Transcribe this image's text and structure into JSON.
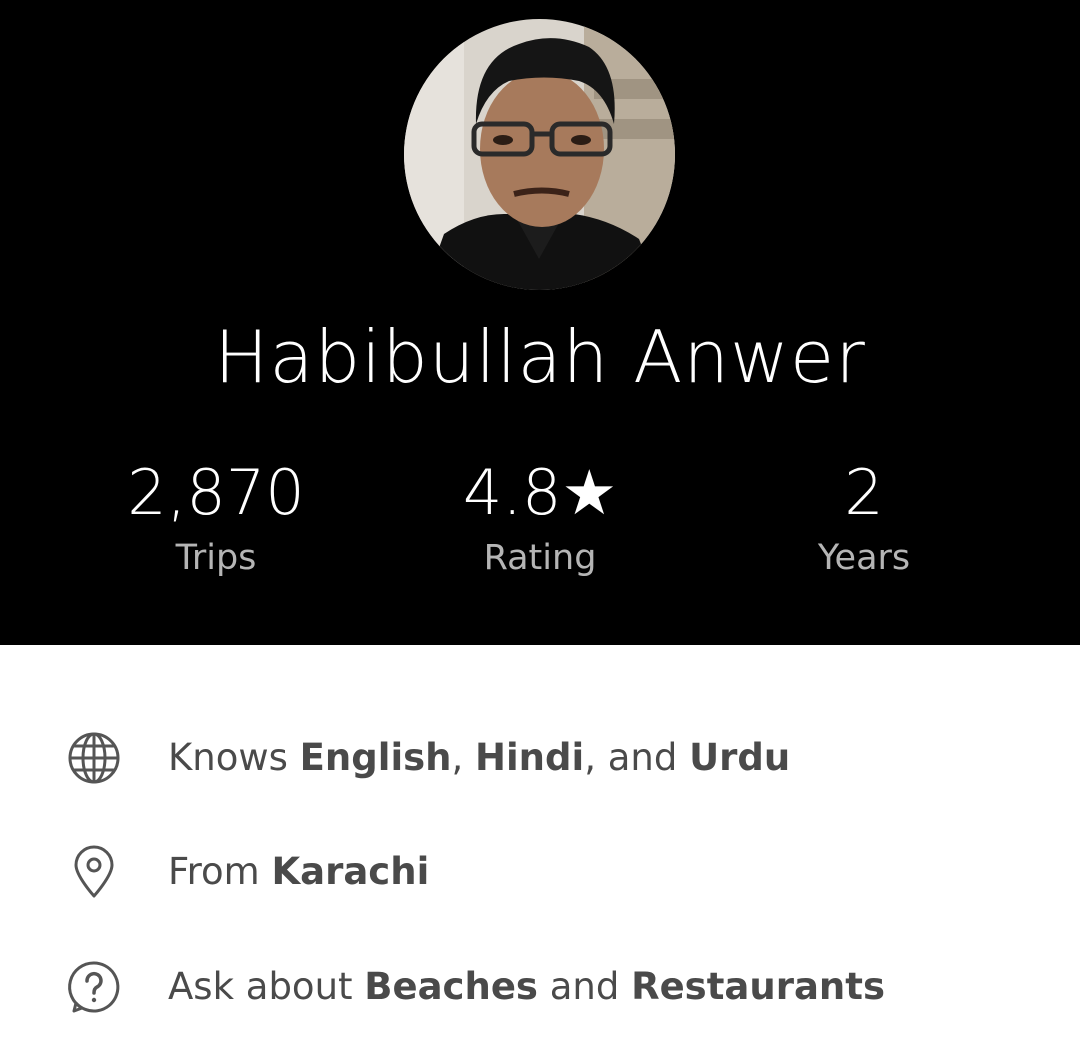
{
  "profile": {
    "name": "Habibullah Anwer",
    "avatar_alt": "driver-photo"
  },
  "stats": {
    "trips": {
      "value": "2,870",
      "label": "Trips"
    },
    "rating": {
      "value": "4.8★",
      "label": "Rating"
    },
    "years": {
      "value": "2",
      "label": "Years"
    }
  },
  "info": {
    "languages": {
      "icon": "globe-icon",
      "prefix": "Knows ",
      "lang1": "English",
      "sep1": ", ",
      "lang2": "Hindi",
      "sep2": ", and ",
      "lang3": "Urdu"
    },
    "from": {
      "icon": "location-pin-icon",
      "prefix": "From ",
      "city": "Karachi"
    },
    "ask": {
      "icon": "question-icon",
      "prefix": "Ask about ",
      "topic1": "Beaches",
      "sep": " and ",
      "topic2": "Restaurants"
    }
  },
  "colors": {
    "header_bg": "#000000",
    "text_primary": "#ffffff",
    "text_secondary": "#b5b5b5",
    "info_text": "#4a4a4a"
  }
}
